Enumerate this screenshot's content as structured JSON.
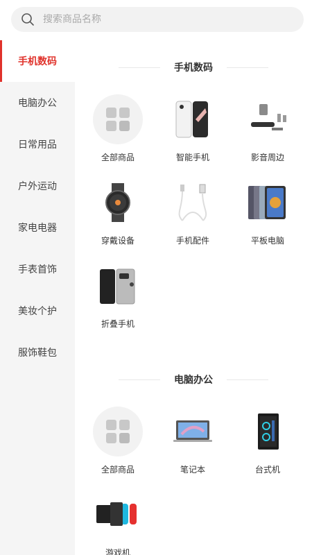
{
  "search": {
    "placeholder": "搜索商品名称"
  },
  "sidebar": {
    "items": [
      {
        "label": "手机数码"
      },
      {
        "label": "电脑办公"
      },
      {
        "label": "日常用品"
      },
      {
        "label": "户外运动"
      },
      {
        "label": "家电电器"
      },
      {
        "label": "手表首饰"
      },
      {
        "label": "美妆个护"
      },
      {
        "label": "服饰鞋包"
      }
    ]
  },
  "sections": [
    {
      "title": "手机数码",
      "items": [
        {
          "label": "全部商品",
          "icon": "all-products-icon"
        },
        {
          "label": "智能手机",
          "icon": "smartphone-icon"
        },
        {
          "label": "影音周边",
          "icon": "speaker-icon"
        },
        {
          "label": "穿戴设备",
          "icon": "smartwatch-icon"
        },
        {
          "label": "手机配件",
          "icon": "usb-cable-icon"
        },
        {
          "label": "平板电脑",
          "icon": "tablet-icon"
        },
        {
          "label": "折叠手机",
          "icon": "foldable-phone-icon"
        }
      ]
    },
    {
      "title": "电脑办公",
      "items": [
        {
          "label": "全部商品",
          "icon": "all-products-icon"
        },
        {
          "label": "笔记本",
          "icon": "laptop-icon"
        },
        {
          "label": "台式机",
          "icon": "desktop-tower-icon"
        },
        {
          "label": "游戏机",
          "icon": "game-console-icon"
        }
      ]
    }
  ],
  "colors": {
    "accent": "#e0322b",
    "sidebar_bg": "#f5f5f5"
  }
}
